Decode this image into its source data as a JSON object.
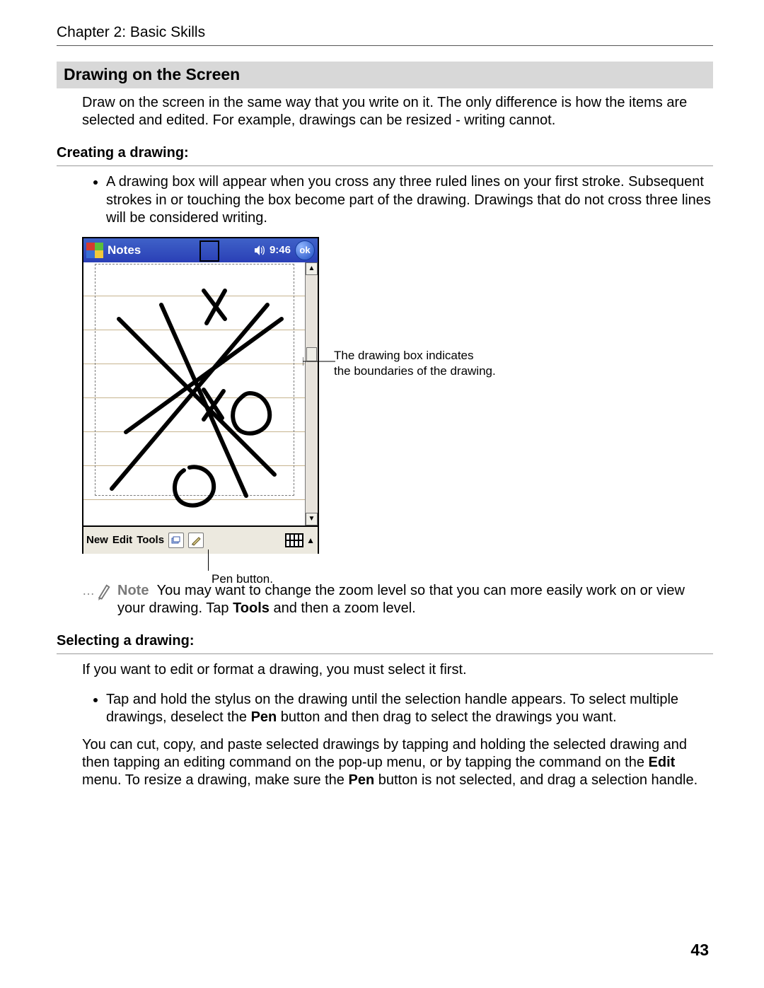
{
  "chapter": "Chapter 2: Basic Skills",
  "h1": "Drawing on the Screen",
  "intro": "Draw on the screen in the same way that you write on it. The only difference is how the items are selected and edited. For example, drawings can be resized - writing cannot.",
  "h2a": "Creating a drawing:",
  "bullet1": "A drawing box will appear when you cross any three ruled lines on your first stroke. Subsequent strokes in or touching the box become part of the drawing. Drawings that do not cross three lines will be considered writing.",
  "device": {
    "app": "Notes",
    "time": "9:46",
    "ok": "ok",
    "menu_new": "New",
    "menu_edit": "Edit",
    "menu_tools": "Tools"
  },
  "callout_box_l1": "The drawing box indicates",
  "callout_box_l2": "the boundaries of the drawing.",
  "callout_pen": "Pen button.",
  "note_label": "Note",
  "note_text_a": "You may want to change the zoom level so that you can more easily work on or view your drawing. Tap ",
  "note_text_bold": "Tools",
  "note_text_b": " and then a zoom level.",
  "h2b": "Selecting a drawing:",
  "sel_intro": "If you want to edit or format a drawing, you must select it first.",
  "sel_bullet_a": "Tap and hold the stylus on the drawing until the selection handle appears. To select multiple drawings, deselect the ",
  "sel_bullet_bold": "Pen",
  "sel_bullet_b": " button and then drag to select the drawings you want.",
  "sel_para2_a": "You can cut, copy, and paste selected drawings by tapping and holding the selected drawing and then tapping an editing command on the pop-up menu, or by tapping the command on the ",
  "sel_para2_bold1": "Edit",
  "sel_para2_b": " menu. To resize a drawing, make sure the ",
  "sel_para2_bold2": "Pen",
  "sel_para2_c": " button is not selected, and drag a selection handle.",
  "page_number": "43"
}
